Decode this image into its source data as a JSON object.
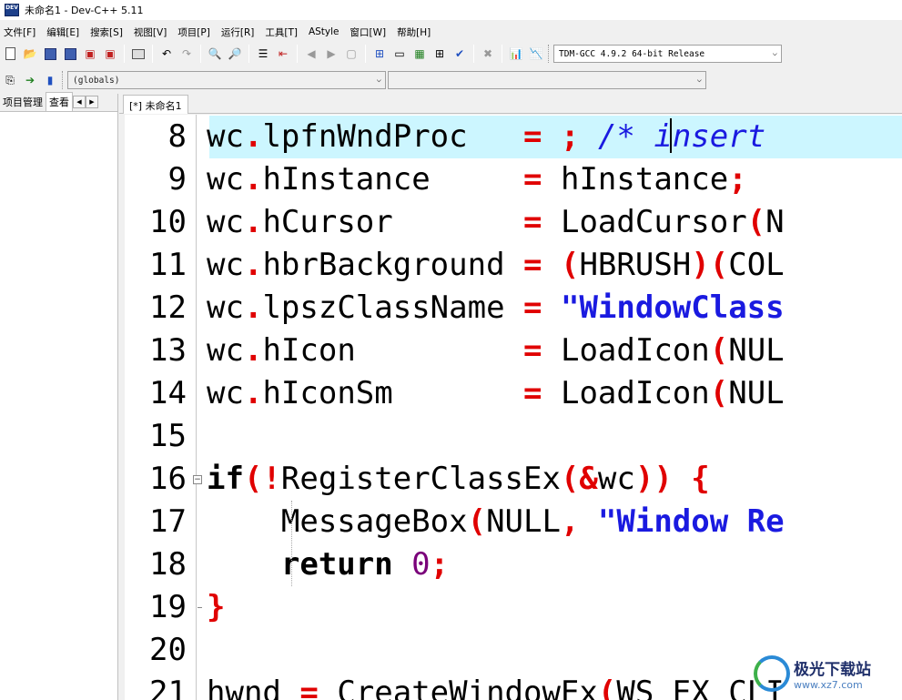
{
  "window": {
    "title": "未命名1 - Dev-C++ 5.11",
    "logo_text": "DEV"
  },
  "menu": {
    "items": [
      "文件[F]",
      "编辑[E]",
      "搜索[S]",
      "视图[V]",
      "项目[P]",
      "运行[R]",
      "工具[T]",
      "AStyle",
      "窗口[W]",
      "帮助[H]"
    ]
  },
  "toolbar": {
    "compiler_select": "TDM-GCC 4.9.2 64-bit Release",
    "scope_select": "(globals)",
    "symbol_select": ""
  },
  "left_panel": {
    "tabs": [
      "项目管理",
      "查看"
    ]
  },
  "editor": {
    "tab_label": "[*] 未命名1",
    "lines": [
      {
        "num": "8",
        "active": true
      },
      {
        "num": "9"
      },
      {
        "num": "10"
      },
      {
        "num": "11"
      },
      {
        "num": "12"
      },
      {
        "num": "13"
      },
      {
        "num": "14"
      },
      {
        "num": "15"
      },
      {
        "num": "16"
      },
      {
        "num": "17"
      },
      {
        "num": "18"
      },
      {
        "num": "19"
      },
      {
        "num": "20"
      },
      {
        "num": "21"
      }
    ],
    "code": {
      "l8_lhs": "wc",
      "l8_dot": ".",
      "l8_member": "lpfnWndProc   ",
      "l8_eq": "=",
      "l8_semi": ";",
      "l8_comment": " /* insert",
      "l9_lhs": "wc",
      "l9_dot": ".",
      "l9_member": "hInstance     ",
      "l9_eq": "=",
      "l9_rhs": " hInstance",
      "l9_semi": ";",
      "l10_lhs": "wc",
      "l10_dot": ".",
      "l10_member": "hCursor       ",
      "l10_eq": "=",
      "l10_rhs": " LoadCursor",
      "l10_paren": "(",
      "l10_rest": "N",
      "l11_lhs": "wc",
      "l11_dot": ".",
      "l11_member": "hbrBackground ",
      "l11_eq": "=",
      "l11_p1": " (",
      "l11_rhs": "HBRUSH",
      "l11_p2": ")(",
      "l11_rest": "COL",
      "l12_lhs": "wc",
      "l12_dot": ".",
      "l12_member": "lpszClassName ",
      "l12_eq": "=",
      "l12_str": " \"WindowClass",
      "l13_lhs": "wc",
      "l13_dot": ".",
      "l13_member": "hIcon         ",
      "l13_eq": "=",
      "l13_rhs": " LoadIcon",
      "l13_paren": "(",
      "l13_rest": "NUL",
      "l14_lhs": "wc",
      "l14_dot": ".",
      "l14_member": "hIconSm       ",
      "l14_eq": "=",
      "l14_rhs": " LoadIcon",
      "l14_paren": "(",
      "l14_rest": "NUL",
      "l16_kw": "if",
      "l16_p1": "(!",
      "l16_fn": "RegisterClassEx",
      "l16_p2": "(&",
      "l16_arg": "wc",
      "l16_p3": "))",
      "l16_brace": " {",
      "l17_fn": "    MessageBox",
      "l17_p1": "(",
      "l17_arg": "NULL",
      "l17_comma": ",",
      "l17_str": " \"Window Re",
      "l18_kw": "    return",
      "l18_num": " 0",
      "l18_semi": ";",
      "l19_brace": "}",
      "l21_lhs": "hwnd ",
      "l21_eq": "=",
      "l21_fn": " CreateWindowEx",
      "l21_p": "(",
      "l21_rest": "WS_EX_CLI"
    }
  },
  "watermark": {
    "main": "极光下载站",
    "sub": "www.xz7.com"
  }
}
